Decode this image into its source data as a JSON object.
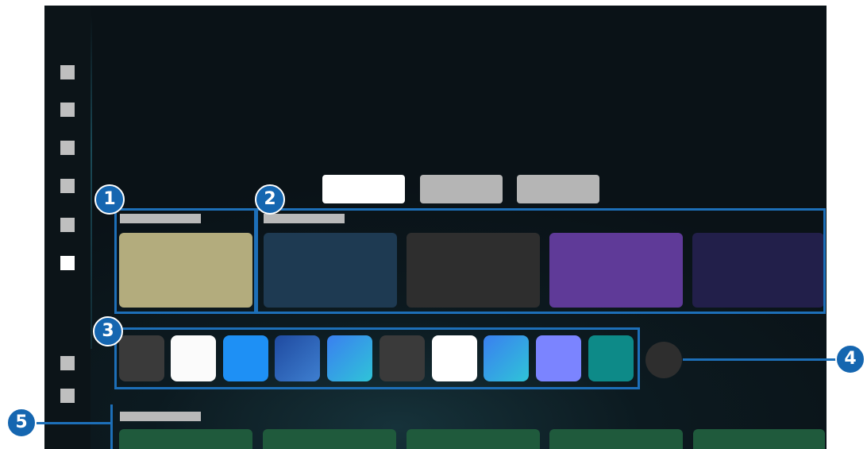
{
  "screen": {
    "sidebar": {
      "nav_items": [
        {
          "state": "inactive"
        },
        {
          "state": "inactive"
        },
        {
          "state": "inactive"
        },
        {
          "state": "inactive"
        },
        {
          "state": "inactive"
        },
        {
          "state": "active"
        },
        {
          "state": "inactive"
        },
        {
          "state": "inactive"
        }
      ]
    },
    "top_tabs": [
      {
        "state": "active"
      },
      {
        "state": "inactive"
      },
      {
        "state": "inactive"
      }
    ],
    "sections": {
      "recent": {
        "tile_color": "#b3ac7d"
      },
      "content_row": {
        "tile_colors": [
          "#1e3a52",
          "#2e2e2e",
          "#5f3a98",
          "#221f4a"
        ]
      },
      "apps": {
        "tile_colors": [
          "#3a3a3a",
          "#fbfbfb",
          "#1e90f5",
          "#2a63b8",
          "#3a8de8",
          "#3a3a3a",
          "#ffffff",
          "#3a8de8",
          "#7b84ff",
          "#0d8a88"
        ]
      },
      "bottom_row": {
        "tile_color": "#1f5a3c"
      }
    }
  },
  "callouts": [
    {
      "number": "1"
    },
    {
      "number": "2"
    },
    {
      "number": "3"
    },
    {
      "number": "4"
    },
    {
      "number": "5"
    }
  ],
  "colors": {
    "callout": "#1d6fb8",
    "screen_background": "#0a1217",
    "sidebar_background": "#0c1418"
  }
}
